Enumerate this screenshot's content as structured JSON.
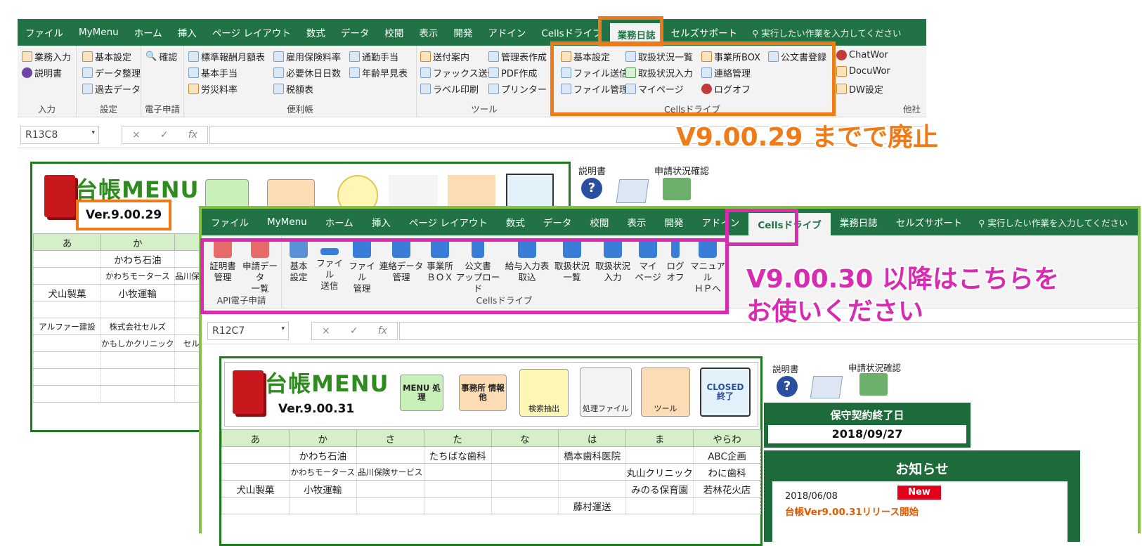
{
  "colors": {
    "excel_green": "#217346",
    "orange": "#f07b16",
    "magenta": "#d92bb1",
    "window_border": "#82c341"
  },
  "old_window": {
    "tabs": [
      "ファイル",
      "MyMenu",
      "ホーム",
      "挿入",
      "ページ レイアウト",
      "数式",
      "データ",
      "校閲",
      "表示",
      "開発",
      "アドイン",
      "Cellsドライブ",
      "業務日誌",
      "セルズサポート"
    ],
    "tellme": "実行したい作業を入力してください",
    "ribbon": {
      "input": {
        "items": [
          "業務入力",
          "説明書"
        ],
        "label": "入力"
      },
      "settings": {
        "items": [
          "基本設定",
          "確認",
          "データ整理",
          "過去データ"
        ],
        "label": "設定"
      },
      "edenshi": {
        "label": "電子申請"
      },
      "benri": {
        "items": [
          "標準報酬月額表",
          "雇用保険料率",
          "通勤手当",
          "基本手当",
          "必要休日日数",
          "年齢早見表",
          "労災料率",
          "税額表"
        ],
        "label": "便利帳"
      },
      "tools": {
        "items": [
          "送付案内",
          "管理表作成",
          "ファックス送信",
          "PDF作成",
          "ラベル印刷",
          "プリンター"
        ],
        "label": "ツール"
      },
      "cells": {
        "items": [
          "基本設定",
          "取扱状況一覧",
          "事業所BOX",
          "公文書登録",
          "ファイル送信",
          "取扱状況入力",
          "連絡管理",
          "ファイル管理",
          "マイページ",
          "ログオフ"
        ],
        "label": "Cellsドライブ"
      },
      "other": {
        "items": [
          "ChatWor",
          "DocuWor",
          "DW設定"
        ],
        "label": "他社"
      }
    },
    "namebox": "R13C8",
    "formula_icons": [
      "×",
      "✓",
      "fx"
    ],
    "title": "台帳MENU",
    "version": "Ver.9.00.29",
    "side_labels": [
      "説明書",
      "申請状況確認"
    ],
    "headers": [
      "あ",
      "か"
    ],
    "rows": [
      [
        "",
        "かわち石油",
        "品川保険"
      ],
      [
        "",
        "かわちモータース",
        ""
      ],
      [
        "犬山製菓",
        "小牧運輸",
        ""
      ],
      [
        "",
        "",
        ""
      ],
      [
        "アルファー建設",
        "株式会社セルズ",
        ""
      ],
      [
        "",
        "かもしかクリニック",
        "セル"
      ]
    ]
  },
  "callout_old": "V9.00.29 までで廃止",
  "new_window": {
    "tabs": [
      "ファイル",
      "MyMenu",
      "ホーム",
      "挿入",
      "ページ レイアウト",
      "数式",
      "データ",
      "校閲",
      "表示",
      "開発",
      "アドイン",
      "Cellsドライブ",
      "業務日誌",
      "セルズサポート"
    ],
    "tellme": "実行したい作業を入力してください",
    "ribbon": {
      "api_label": "API電子申請",
      "cells_label": "Cellsドライブ",
      "api_items": [
        [
          "証明書",
          "管理"
        ],
        [
          "申請データ",
          "一覧"
        ]
      ],
      "cells_items": [
        [
          "基本",
          "設定"
        ],
        [
          "ファイル",
          "送信"
        ],
        [
          "ファイル",
          "管理"
        ],
        [
          "連絡データ",
          "管理"
        ],
        [
          "事業所",
          "ＢＯＸ"
        ],
        [
          "公文書",
          "アップロード"
        ],
        [
          "給与入力表",
          "取込"
        ],
        [
          "取扱状況",
          "一覧"
        ],
        [
          "取扱状況",
          "入力"
        ],
        [
          "マイ",
          "ページ"
        ],
        [
          "ログ",
          "オフ"
        ],
        [
          "マニュアル",
          "ＨＰへ"
        ]
      ]
    },
    "namebox": "R12C7",
    "title": "台帳MENU",
    "version": "Ver.9.00.31",
    "menu_buttons": [
      "MENU 処理",
      "事務所 情報他",
      "検索抽出",
      "処理ファイル",
      "ツール",
      "CLOSED 終了"
    ],
    "side_labels": [
      "説明書",
      "申請状況確認"
    ],
    "maint_label": "保守契約終了日",
    "maint_date": "2018/09/27",
    "news_title": "お知らせ",
    "news_date": "2018/06/08",
    "news_badge": "New",
    "news_text": "台帳Ver9.00.31リリース開始",
    "headers": [
      "あ",
      "か",
      "さ",
      "た",
      "な",
      "は",
      "ま",
      "やらわ"
    ],
    "rows": [
      [
        "",
        "かわち石油",
        "",
        "たちばな歯科",
        "",
        "橋本歯科医院",
        "",
        "ABC企画"
      ],
      [
        "",
        "かわちモータース",
        "品川保険サービス",
        "",
        "",
        "",
        "丸山クリニック",
        "わに歯科"
      ],
      [
        "犬山製菓",
        "小牧運輸",
        "",
        "",
        "",
        "",
        "みのる保育園",
        "若林花火店"
      ],
      [
        "",
        "",
        "",
        "",
        "",
        "藤村運送",
        "",
        ""
      ]
    ]
  },
  "callout_new": [
    "V9.00.30 以降はこちらを",
    "お使いください"
  ]
}
